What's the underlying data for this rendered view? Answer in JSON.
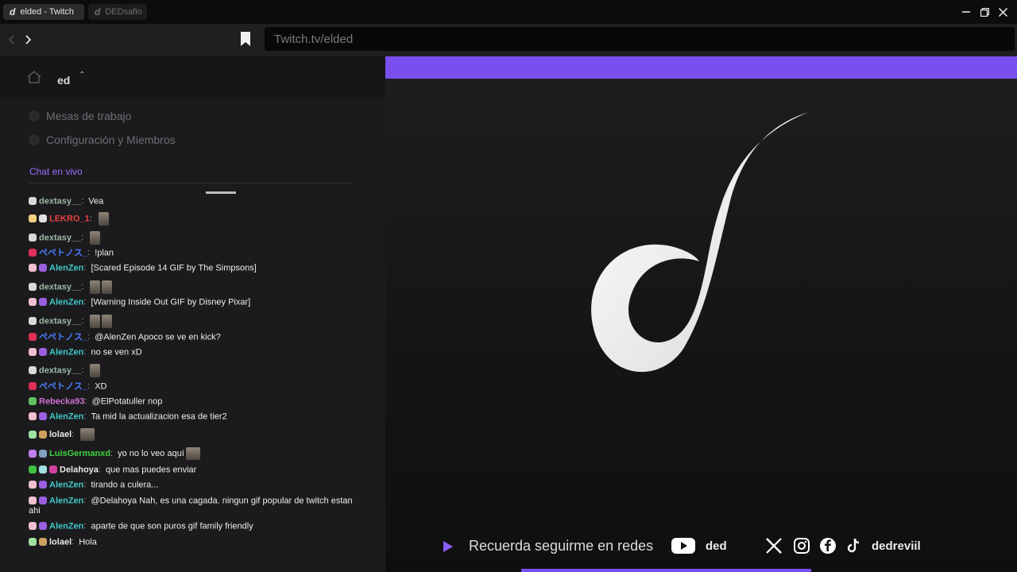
{
  "tabs": [
    {
      "label": "elded - Twitch"
    },
    {
      "label": "DEDsafio"
    }
  ],
  "url": "Twitch.tv/elded",
  "workspace": {
    "name": "ed"
  },
  "menu": [
    {
      "label": "Mesas de trabajo"
    },
    {
      "label": "Configuración y Miembros"
    }
  ],
  "chat_section_label": "Chat en vivo",
  "chat": [
    {
      "user": "dextasy__",
      "color": "#9bb8a4",
      "text": "Vea",
      "badges": [
        "#d9d9d9"
      ],
      "emotes": 0
    },
    {
      "user": "LEKRO_1",
      "color": "#e84040",
      "text": "",
      "badges": [
        "#f0d080",
        "#e0e0e0"
      ],
      "emotes": 1
    },
    {
      "user": "dextasy__",
      "color": "#9bb8a4",
      "text": "",
      "badges": [
        "#d9d9d9"
      ],
      "emotes": 1
    },
    {
      "user": "ペペトノス_",
      "color": "#4a7cff",
      "text": "!plan",
      "badges": [
        "#e0305a"
      ],
      "emotes": 0
    },
    {
      "user": "AlenZen",
      "color": "#42c8c8",
      "text": "[Scared Episode 14 GIF by The Simpsons]",
      "badges": [
        "#f0c0d0",
        "#9a60e0"
      ],
      "emotes": 0
    },
    {
      "user": "dextasy__",
      "color": "#9bb8a4",
      "text": "",
      "badges": [
        "#d9d9d9"
      ],
      "emotes": 2
    },
    {
      "user": "AlenZen",
      "color": "#42c8c8",
      "text": "[Warning Inside Out GIF by Disney Pixar]",
      "badges": [
        "#f0c0d0",
        "#9a60e0"
      ],
      "emotes": 0
    },
    {
      "user": "dextasy__",
      "color": "#9bb8a4",
      "text": "",
      "badges": [
        "#d9d9d9"
      ],
      "emotes": 2
    },
    {
      "user": "ペペトノス_",
      "color": "#4a7cff",
      "text": "@AlenZen Apoco se ve en kick?",
      "badges": [
        "#e0305a"
      ],
      "emotes": 0
    },
    {
      "user": "AlenZen",
      "color": "#42c8c8",
      "text": "no se ven xD",
      "badges": [
        "#f0c0d0",
        "#9a60e0"
      ],
      "emotes": 0
    },
    {
      "user": "dextasy__",
      "color": "#9bb8a4",
      "text": "",
      "badges": [
        "#d9d9d9"
      ],
      "emotes": 1
    },
    {
      "user": "ペペトノス_",
      "color": "#4a7cff",
      "text": "XD",
      "badges": [
        "#e0305a"
      ],
      "emotes": 0
    },
    {
      "user": "Rebecka93",
      "color": "#d070d0",
      "text": "@ElPotatuller nop",
      "badges": [
        "#60c060"
      ],
      "emotes": 0
    },
    {
      "user": "AlenZen",
      "color": "#42c8c8",
      "text": "Ta mid la actualizacion esa de tier2",
      "badges": [
        "#f0c0d0",
        "#9a60e0"
      ],
      "emotes": 0
    },
    {
      "user": "lolael",
      "color": "#e8e8e8",
      "text": "",
      "badges": [
        "#a0e0a0",
        "#d0a060"
      ],
      "emotes": 1
    },
    {
      "user": "LuisGermanxd",
      "color": "#40d040",
      "text": "yo no lo veo aquí",
      "badges": [
        "#c080f0",
        "#80a0c0"
      ],
      "emotes": 1
    },
    {
      "user": "Delahoya",
      "color": "#e8e8e8",
      "text": "que mas puedes enviar",
      "badges": [
        "#40c040",
        "#a0e0e0",
        "#d040a0"
      ],
      "emotes": 0
    },
    {
      "user": "AlenZen",
      "color": "#42c8c8",
      "text": "tirando a culera...",
      "badges": [
        "#f0c0d0",
        "#9a60e0"
      ],
      "emotes": 0
    },
    {
      "user": "AlenZen",
      "color": "#42c8c8",
      "text": "@Delahoya Nah, es una cagada. ningun gif popular de twitch estan ahi",
      "badges": [
        "#f0c0d0",
        "#9a60e0"
      ],
      "emotes": 0
    },
    {
      "user": "AlenZen",
      "color": "#42c8c8",
      "text": "aparte de que son puros gif family friendly",
      "badges": [
        "#f0c0d0",
        "#9a60e0"
      ],
      "emotes": 0
    },
    {
      "user": "lolael",
      "color": "#e8e8e8",
      "text": "Hola",
      "badges": [
        "#a0e0a0",
        "#d0a060"
      ],
      "emotes": 0
    }
  ],
  "stream": {
    "remember_text": "Recuerda seguirme en redes",
    "youtube_handle": "ded",
    "social_handle": "dedreviil",
    "accent_color": "#7a4ff0"
  }
}
